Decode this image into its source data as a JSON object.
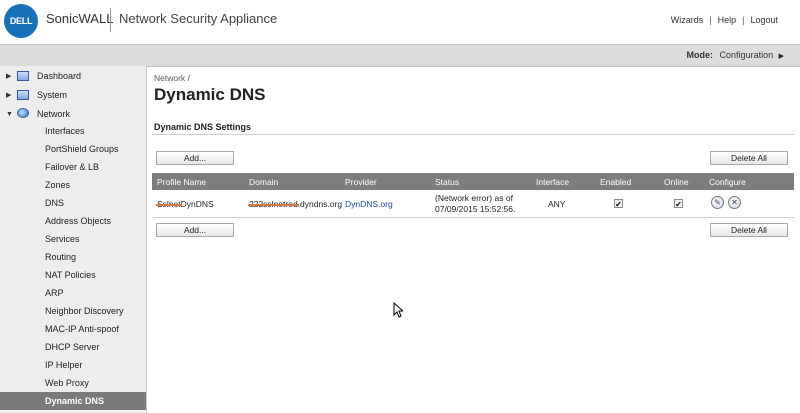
{
  "header": {
    "logo_text": "DELL",
    "brand": "SonicWALL",
    "product": "Network Security Appliance",
    "links": {
      "wizards": "Wizards",
      "help": "Help",
      "logout": "Logout"
    },
    "link_separator": "|"
  },
  "modebar": {
    "label": "Mode:",
    "value": "Configuration",
    "arrow": "▶"
  },
  "sidebar": {
    "top_items": [
      {
        "label": "Dashboard",
        "icon": "dashboard-icon",
        "expanded": false
      },
      {
        "label": "System",
        "icon": "monitor-icon",
        "expanded": false
      },
      {
        "label": "Network",
        "icon": "network-globe-icon",
        "expanded": true
      }
    ],
    "expand_glyphs": {
      "collapsed": "▶",
      "expanded": "▼"
    },
    "network_items": [
      "Interfaces",
      "PortShield Groups",
      "Failover & LB",
      "Zones",
      "DNS",
      "Address Objects",
      "Services",
      "Routing",
      "NAT Policies",
      "ARP",
      "Neighbor Discovery",
      "MAC-IP Anti-spoof",
      "DHCP Server",
      "IP Helper",
      "Web Proxy",
      "Dynamic DNS"
    ],
    "active_item": "Dynamic DNS"
  },
  "page": {
    "breadcrumb": "Network /",
    "title": "Dynamic DNS",
    "section_title": "Dynamic DNS Settings",
    "add_label": "Add...",
    "delete_all_label": "Delete All"
  },
  "table": {
    "columns": [
      "Profile Name",
      "Domain",
      "Provider",
      "Status",
      "Interface",
      "Enabled",
      "Online",
      "Configure"
    ],
    "rows": [
      {
        "profile_redacted": "Sslnet",
        "profile_suffix": "DynDNS",
        "domain_redacted": "222sslnetred",
        "domain_suffix": ".dyndns.org",
        "provider": "DynDNS.org",
        "status_line1": "(Network error) as of",
        "status_line2": "07/09/2015 15:52:56.",
        "interface": "ANY",
        "enabled": true,
        "online": true,
        "check_glyph": "✔"
      }
    ],
    "configure_icons": {
      "edit": "✎",
      "delete": "✕"
    }
  },
  "colors": {
    "header_bar": "#dcdcdc",
    "sidebar_bg": "#ededed",
    "active_nav": "#7a7a7a",
    "table_header": "#7d7d7d",
    "link": "#1a4a9a",
    "logo": "#1870b8"
  }
}
